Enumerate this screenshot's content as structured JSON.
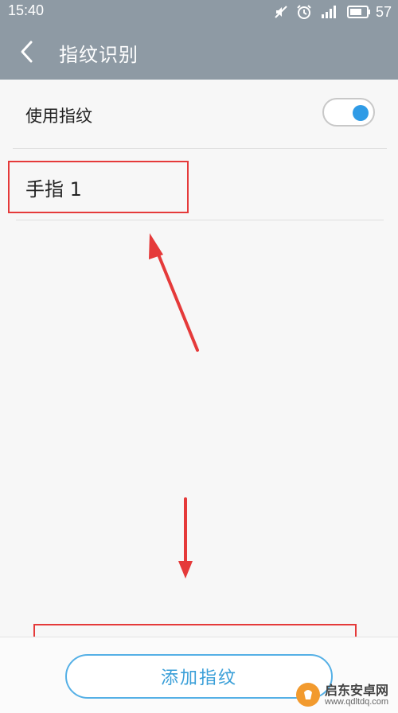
{
  "status_bar": {
    "time": "15:40",
    "battery_level": "57",
    "icons": [
      "mute-icon",
      "alarm-icon",
      "signal-icon",
      "battery-icon"
    ]
  },
  "header": {
    "back_icon": "chevron-left-icon",
    "title": "指纹识别"
  },
  "settings": {
    "use_fingerprint_label": "使用指纹",
    "use_fingerprint_enabled": true
  },
  "fingerprints": [
    {
      "label": "手指 1"
    }
  ],
  "footer": {
    "add_button_label": "添加指纹"
  },
  "watermark": {
    "title": "启东安卓网",
    "url": "www.qdltdq.com"
  },
  "colors": {
    "header_bg": "#8e9aa4",
    "accent": "#2f9be6",
    "annotation": "#e53a3a"
  }
}
